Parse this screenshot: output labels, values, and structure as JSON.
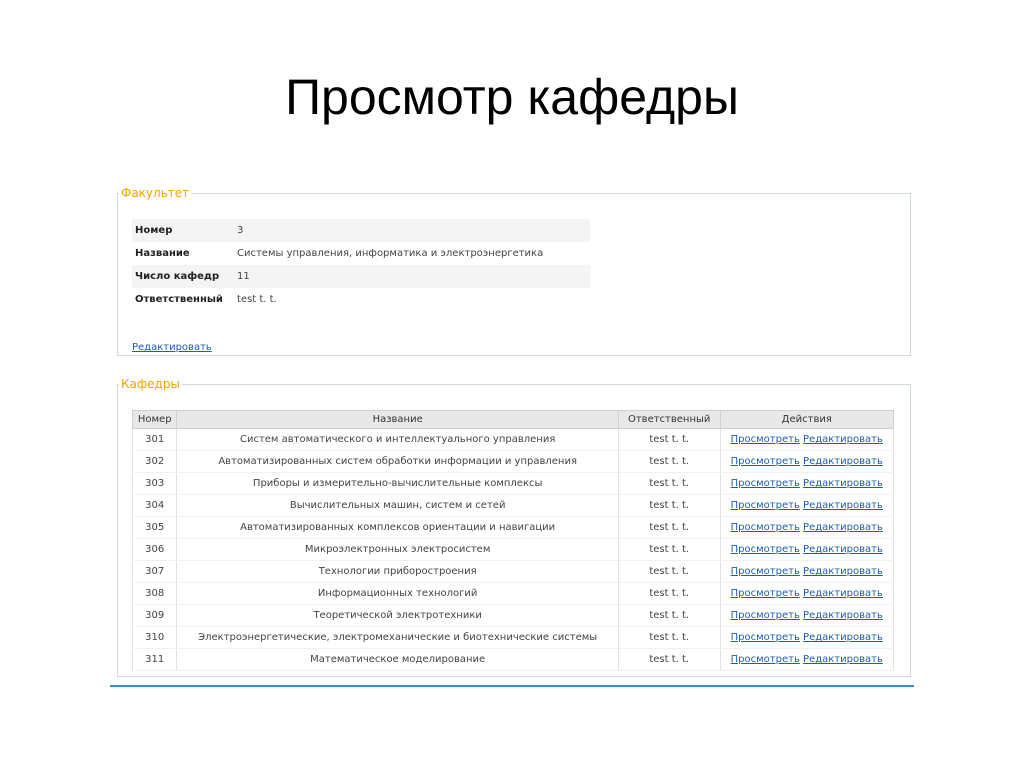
{
  "title": "Просмотр кафедры",
  "faculty": {
    "legend": "Факультет",
    "rows": [
      {
        "label": "Номер",
        "value": "3"
      },
      {
        "label": "Название",
        "value": "Системы управления, информатика и электроэнергетика"
      },
      {
        "label": "Число кафедр",
        "value": "11"
      },
      {
        "label": "Ответственный",
        "value": "test t. t."
      }
    ],
    "edit_label": "Редактировать"
  },
  "departments": {
    "legend": "Кафедры",
    "headers": {
      "number": "Номер",
      "name": "Название",
      "responsible": "Ответственный",
      "actions": "Действия"
    },
    "view_label": "Просмотреть",
    "edit_label": "Редактировать",
    "rows": [
      {
        "number": "301",
        "name": "Систем автоматического и интеллектуального управления",
        "responsible": "test t. t."
      },
      {
        "number": "302",
        "name": "Автоматизированных систем обработки информации и управления",
        "responsible": "test t. t."
      },
      {
        "number": "303",
        "name": "Приборы и измерительно-вычислительные комплексы",
        "responsible": "test t. t."
      },
      {
        "number": "304",
        "name": "Вычислительных машин, систем и сетей",
        "responsible": "test t. t."
      },
      {
        "number": "305",
        "name": "Автоматизированных комплексов ориентации и навигации",
        "responsible": "test t. t."
      },
      {
        "number": "306",
        "name": "Микроэлектронных электросистем",
        "responsible": "test t. t."
      },
      {
        "number": "307",
        "name": "Технологии приборостроения",
        "responsible": "test t. t."
      },
      {
        "number": "308",
        "name": "Информационных технологий",
        "responsible": "test t. t."
      },
      {
        "number": "309",
        "name": "Теоретической электротехники",
        "responsible": "test t. t."
      },
      {
        "number": "310",
        "name": "Электроэнергетические, электромеханические и биотехнические системы",
        "responsible": "test t. t."
      },
      {
        "number": "311",
        "name": "Математическое моделирование",
        "responsible": "test t. t."
      }
    ]
  },
  "colors": {
    "legend": "#f0a400",
    "link": "#1a5fb4",
    "bottom_rule": "#3a8fc8"
  }
}
